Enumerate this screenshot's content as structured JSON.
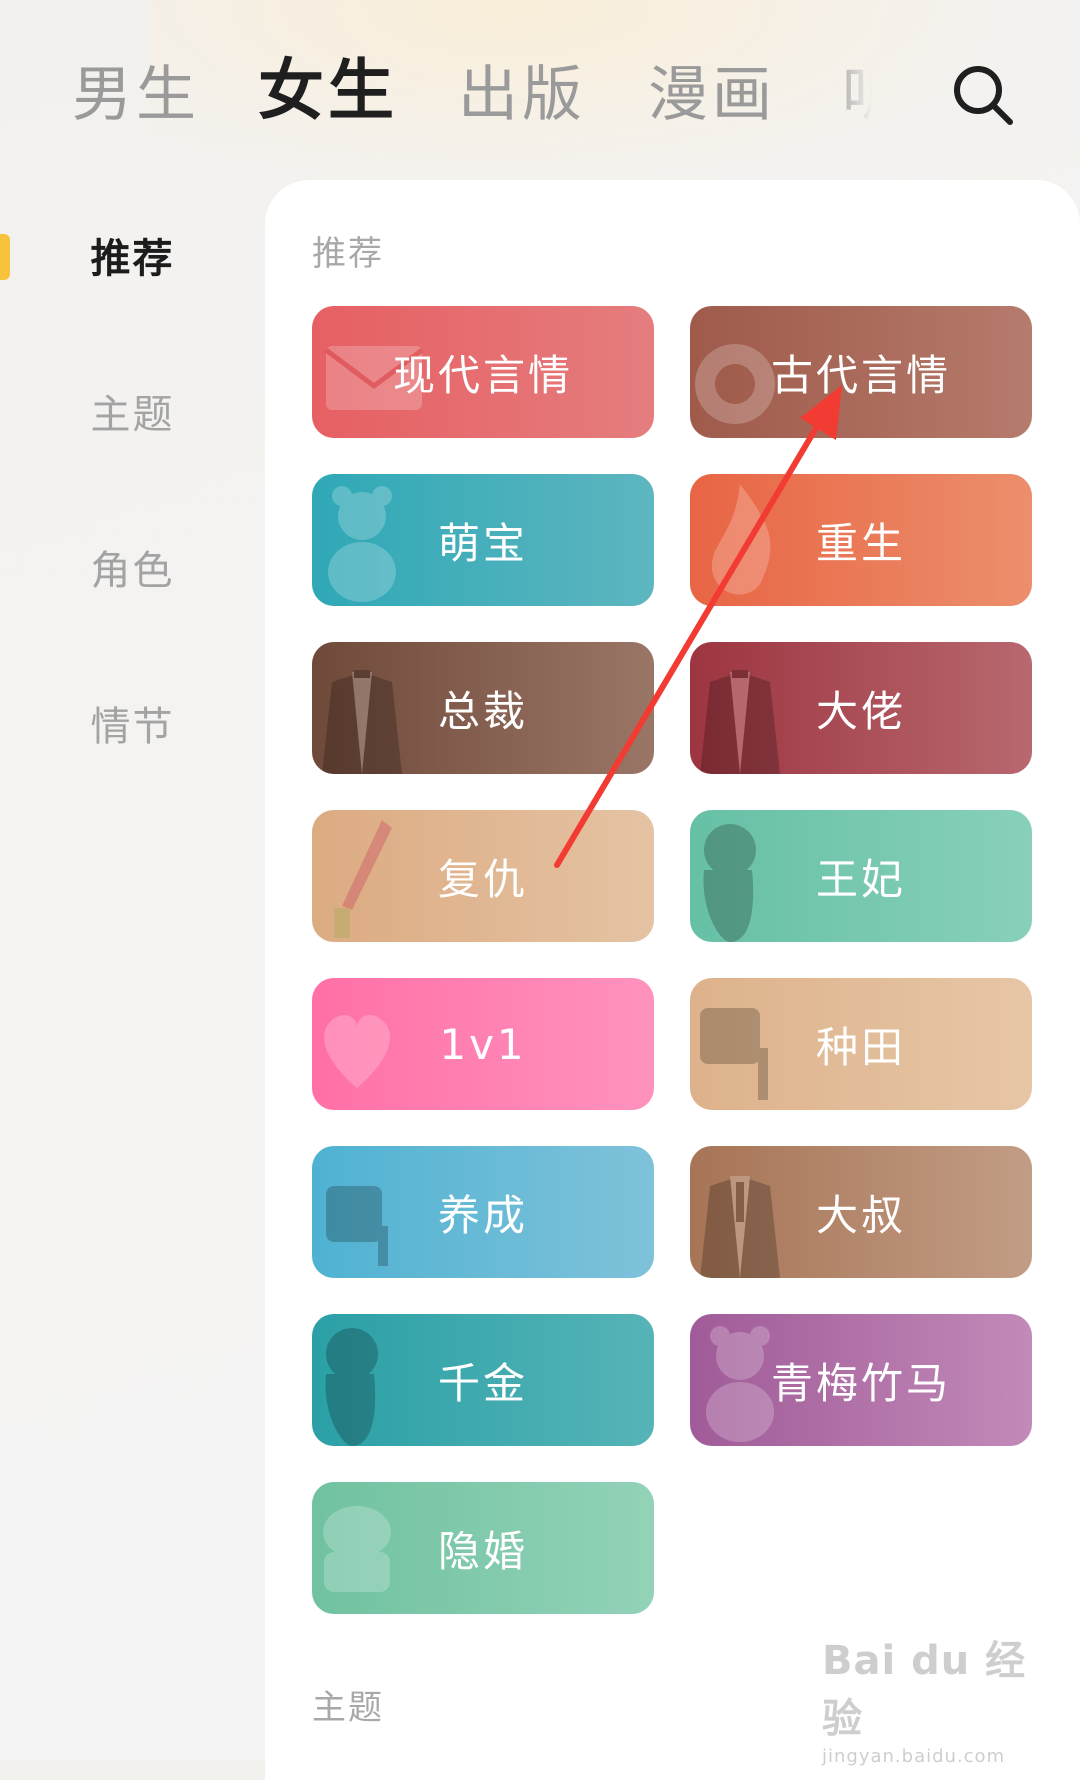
{
  "top_tabs": [
    {
      "label": "男生"
    },
    {
      "label": "女生"
    },
    {
      "label": "出版"
    },
    {
      "label": "漫画"
    },
    {
      "label": "听"
    }
  ],
  "active_tab": "女生",
  "search_icon": "search-icon",
  "sidebar": {
    "items": [
      {
        "label": "推荐"
      },
      {
        "label": "主题"
      },
      {
        "label": "角色"
      },
      {
        "label": "情节"
      }
    ],
    "active": "推荐",
    "indicator_color": "#f8c33c"
  },
  "sections": [
    {
      "title": "推荐"
    },
    {
      "title": "主题"
    }
  ],
  "categories": [
    {
      "label": "现代言情",
      "color_from": "#e65f63",
      "color_to": "#e57d7e",
      "icon": "letter-icon"
    },
    {
      "label": "古代言情",
      "color_from": "#9f5a4a",
      "color_to": "#b57b6c",
      "icon": "fan-icon"
    },
    {
      "label": "萌宝",
      "color_from": "#2fa8b6",
      "color_to": "#5db6c0",
      "icon": "teddy-bear-icon"
    },
    {
      "label": "重生",
      "color_from": "#e86544",
      "color_to": "#ec8f6c",
      "icon": "fire-icon"
    },
    {
      "label": "总裁",
      "color_from": "#6f4939",
      "color_to": "#9a7666",
      "icon": "suit-icon"
    },
    {
      "label": "大佬",
      "color_from": "#9d3540",
      "color_to": "#b8686f",
      "icon": "suit-icon"
    },
    {
      "label": "复仇",
      "color_from": "#dcab82",
      "color_to": "#e5c3a3",
      "icon": "dagger-icon"
    },
    {
      "label": "王妃",
      "color_from": "#66c0a6",
      "color_to": "#88d0bb",
      "icon": "lady-icon"
    },
    {
      "label": "1v1",
      "color_from": "#ff6fa6",
      "color_to": "#ff93bd",
      "icon": "heart-icon"
    },
    {
      "label": "种田",
      "color_from": "#ddb28b",
      "color_to": "#e7c6a6",
      "icon": "shovel-icon"
    },
    {
      "label": "养成",
      "color_from": "#4fb2d2",
      "color_to": "#7fc2da",
      "icon": "watering-can-icon"
    },
    {
      "label": "大叔",
      "color_from": "#a77456",
      "color_to": "#c29d85",
      "icon": "suit-icon"
    },
    {
      "label": "千金",
      "color_from": "#2aa0a6",
      "color_to": "#56b4b7",
      "icon": "lady-icon"
    },
    {
      "label": "青梅竹马",
      "color_from": "#a05b98",
      "color_to": "#c28ab8",
      "icon": "teddy-bear-icon"
    },
    {
      "label": "隐婚",
      "color_from": "#70c2a1",
      "color_to": "#93d2b8",
      "icon": "ring-box-icon"
    }
  ],
  "annotation_arrow_color": "#f23c33",
  "watermark": {
    "main": "Bai du 经验",
    "sub": "jingyan.baidu.com"
  }
}
